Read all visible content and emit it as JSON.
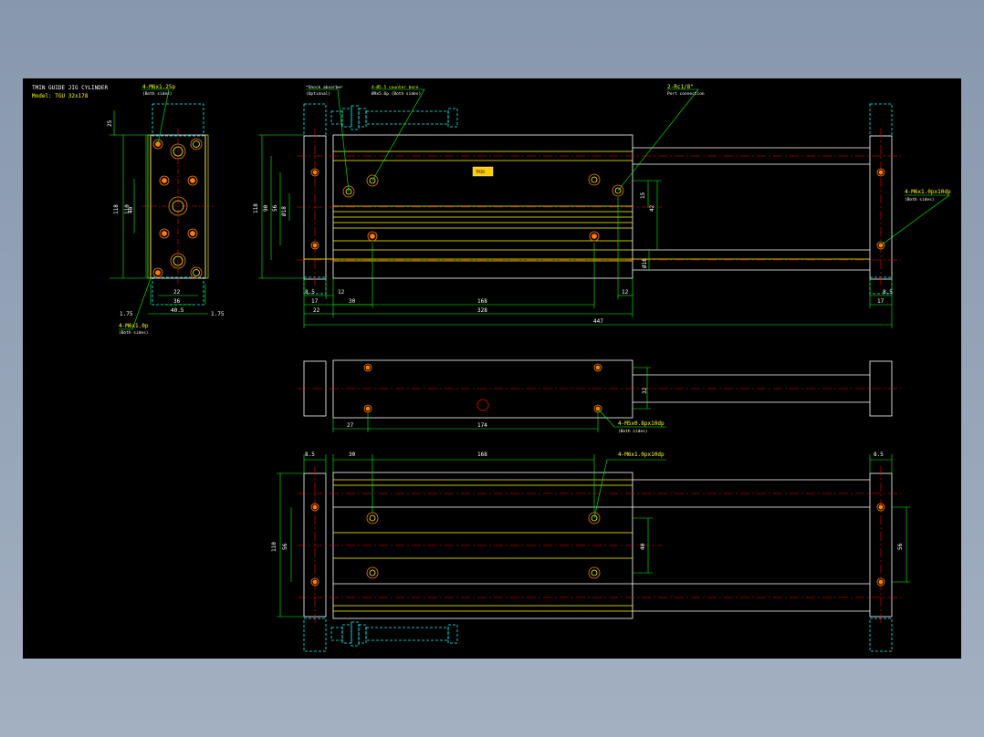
{
  "header": {
    "title": "TMIN GUIDE JIG CYLINDER",
    "model": "Model: TGU 32x178"
  },
  "colors": {
    "background": "#000000",
    "body_outline": "#ffffff",
    "rail": "#ffff00",
    "dimension": "#00ff00",
    "center_line": "#ff0000",
    "hidden": "#00ffff",
    "hole": "#ff8000"
  },
  "annotations": {
    "tap_top_left": "4-M6x1.25p",
    "tap_top_left_sub": "(Both sides)",
    "tap_bottom_left": "4-M6x1.0p",
    "tap_bottom_left_sub": "(Both sides)",
    "shock_absorber": "*Shock absorber",
    "shock_absorber_sub": "(Optional)",
    "counter_bore": "4-Ø5.5 counter bore",
    "counter_bore_sub": "Ø9x5.6p (Both sides)",
    "port": "2-Rc1/8\"",
    "port_sub": "Port connection",
    "tap_right": "4-M6x1.0px10dp",
    "tap_right_sub": "(Both sides)",
    "tap_mid": "4-M5x0.8px10dp",
    "tap_mid_sub": "(Both sides)",
    "tap_bottom": "4-M6x1.0px10dp",
    "nameplate": "TMIN"
  },
  "dims": {
    "side_25": "25",
    "side_118": "118",
    "side_110": "110",
    "side_40": "40",
    "side_22": "22",
    "side_36": "36",
    "side_40_5": "40.5",
    "side_1_75a": "1.75",
    "side_1_75b": "1.75",
    "front_118": "118",
    "front_90": "90",
    "front_56": "56",
    "front_18": "Ø18",
    "front_15": "15",
    "front_42": "42",
    "front_16": "Ø16",
    "front_8_5": "8.5",
    "front_12a": "12",
    "front_17": "17",
    "front_30": "30",
    "front_168": "168",
    "front_12b": "12",
    "front_22": "22",
    "front_328": "328",
    "front_447": "447",
    "front_17r": "17",
    "front_8_5r": "8.5",
    "mid_32": "32",
    "mid_27": "27",
    "mid_174": "174",
    "bot_8_5": "8.5",
    "bot_30": "30",
    "bot_168": "168",
    "bot_8_5r": "8.5",
    "bot_110": "110",
    "bot_56": "56",
    "bot_40": "40",
    "bot_56r": "56"
  }
}
